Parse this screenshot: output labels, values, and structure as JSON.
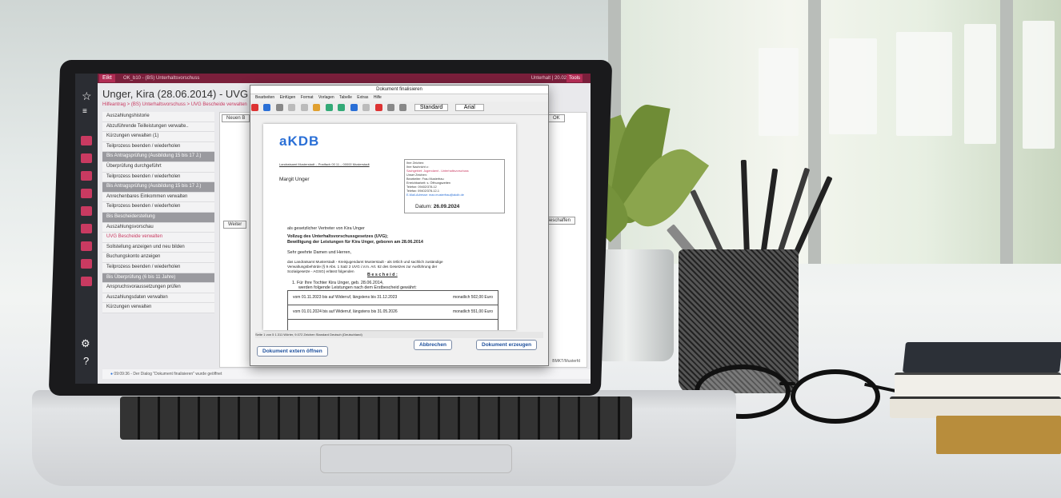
{
  "app": {
    "tab_badge": "Eikt",
    "tab_crumb": "OK_b10 - (BS) Unterhaltsvorschuss",
    "right_info": "Unterhalt  |  20.02",
    "tools_button": "Tools",
    "person_title": "Unger, Kira (28.06.2014) - UVG",
    "breadcrumb": "Hilfeantrag > (BS) Unterhaltsvorschuss > UVG Bescheide verwalten",
    "sidebar_items": [
      "Auszahlungshistorie",
      "Abzuführende Teilleistungen verwalte..",
      "Kürzungen verwalten (1)",
      "Teilprozess beenden / wiederholen",
      "Bis Antragsprüfung (Ausbildung 15 bis 17 J.)",
      "Überprüfung durchgeführt",
      "Teilprozess beenden / wiederholen",
      "Bis Antragsprüfung (Ausbildung 15 bis 17 J.)",
      "Anrechenbares Einkommen verwalten",
      "Teilprozess beenden / wiederholen",
      "Bis Bescheiderstellung",
      "Auszahlungsvorschau",
      "UVG Bescheide verwalten",
      "Sollstellung anzeigen und neu bilden",
      "Buchungskonto anzeigen",
      "Teilprozess beenden / wiederholen",
      "Bis Überprüfung (6 bis 11 Jahre)",
      "Anspruchsvoraussetzungen prüfen",
      "Auszahlungsdaten verwalten",
      "Kürzungen verwalten"
    ],
    "new_button": "Neuen B",
    "weiter_button": "Weiter",
    "ok_button": "OK",
    "beschaften_button": "Beschaffen",
    "status_message": "09:09:36 - Der Dialog \"Dokument finalisieren\" wurde geöffnet",
    "footer_right": "BMKT/Musterfd"
  },
  "dialog": {
    "title": "Dokument finalisieren",
    "menu": [
      "Bearbeiten",
      "Einfügen",
      "Format",
      "Vorlagen",
      "Tabelle",
      "Extras",
      "Hilfe"
    ],
    "style_box": "Standard",
    "font_box": "Arial",
    "status_bar": "Seite 1 von 5   1.311 Wörter, 9.072 Zeichen   Standard   Deutsch (Deutschland)",
    "open_external": "Dokument extern öffnen",
    "cancel": "Abbrechen",
    "create": "Dokument erzeugen"
  },
  "document": {
    "logo": "aKDB",
    "sender_line": "Landratsamt Musterstadt – Postfach 00 11 – 00000 Musterstadt",
    "recipient": "Margit Unger",
    "info_box": [
      "Ihre Zeichen:",
      "Ihre Nachricht v.:",
      "Sachgebiet: Jugendamt - Unterhaltsvorschuss",
      "Unser Zeichen:",
      "Bearbeiter: Frau Musterfrau",
      "Erreichbarkeit: s. Öffnungszeiten",
      "Telefon: 09402/378-12",
      "Telefax: 09402/378-12-1",
      "E-Mail-Adresse: max.musterfrau@akdb.de"
    ],
    "date_label": "Datum:",
    "date_value": "26.09.2024",
    "intro": "als gesetzlicher Vertreter von Kira Unger",
    "subject_line1": "Vollzug des Unterhaltsvorschussgesetzes (UVG);",
    "subject_line2": "Bewilligung der Leistungen für Kira Unger, geboren am 28.06.2014",
    "salutation": "Sehr geehrte Damen und Herren,",
    "body_line1": "das Landratsamt Musterstadt - Kreisjugendamt Musterstadt - als örtlich und sachlich zuständige",
    "body_line2": "Verwaltungsbehörde (§ 9 Abs. 1 Satz 2 UVG i.V.m. Art. 62 des Gesetzes zur Ausführung der",
    "body_line3": "Sozialgesetze - AGSG) erlässt folgenden",
    "bescheid": "B e s c h e i d :",
    "point1_line1": "1.  Für Ihre Tochter Kira Unger, geb. 28.06.2014,",
    "point1_line2": "werden folgende Leistungen nach dem Erstbescheid gewährt:",
    "rows": [
      {
        "period": "vom 01.11.2023 bis auf Widerruf, längstens bis 31.12.2023",
        "amount": "monatlich  502,00 Euro"
      },
      {
        "period": "vom 01.01.2024 bis auf Widerruf, längstens bis 31.05.2026",
        "amount": "monatlich  551,00 Euro"
      }
    ]
  }
}
